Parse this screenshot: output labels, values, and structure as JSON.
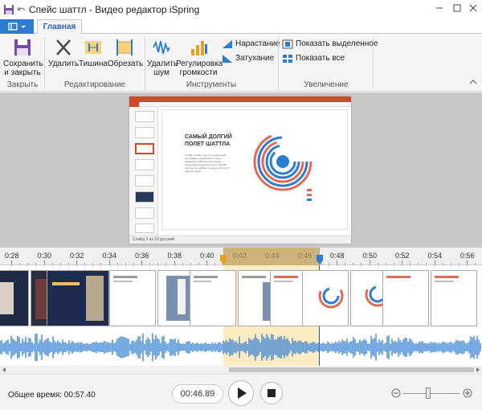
{
  "window": {
    "title": "Спейс шаттл - Видео редактор iSpring"
  },
  "ribbon": {
    "tab_home": "Главная",
    "groups": {
      "close": "Закрыть",
      "editing": "Редактирование",
      "tools": "Инструменты",
      "zoom": "Увеличение"
    },
    "buttons": {
      "save_close": [
        "Сохранить",
        "и закрыть"
      ],
      "delete": "Удалить",
      "silence": "Тишина",
      "trim": "Обрезать",
      "remove_noise": [
        "Удалить",
        "шум"
      ],
      "adjust_volume": [
        "Регулировка",
        "громкости"
      ],
      "fade_in": "Нарастание",
      "fade_out": "Затухание",
      "show_selected": "Показать выделенное",
      "show_all": "Показать все"
    }
  },
  "slide": {
    "app_title": "Space Shuttle - PowerPoint",
    "heading_line1": "САМЫЙ ДОЛГИЙ",
    "heading_line2": "ПОЛЕТ ШАТТЛА",
    "body_text": "С 1981 по 2011 годы по космической программе «Спейс Шаттл» было совершено 135 полетов. Самым продолжительным был полет STS-80, шаттла «Колумбия», который длился 17 дней 15 часов.",
    "status_bar": "Слайд 3 из 10   русский"
  },
  "timeline": {
    "ticks": [
      "0:28",
      "0:30",
      "0:32",
      "0:34",
      "0:36",
      "0:38",
      "0:40",
      "0:42",
      "0:44",
      "0:46",
      "0:48",
      "0:50",
      "0:52",
      "0:54",
      "0:56"
    ],
    "selection_start": "0:41.3",
    "selection_end": "0:47.2",
    "playhead": "0:46.89"
  },
  "playback": {
    "total_time": "Общее время: 00:57.40",
    "current_time": "00:46.89"
  },
  "colors": {
    "accent": "#2b7cd3",
    "selection": "#f7d98a",
    "wave": "#3d86d6"
  }
}
